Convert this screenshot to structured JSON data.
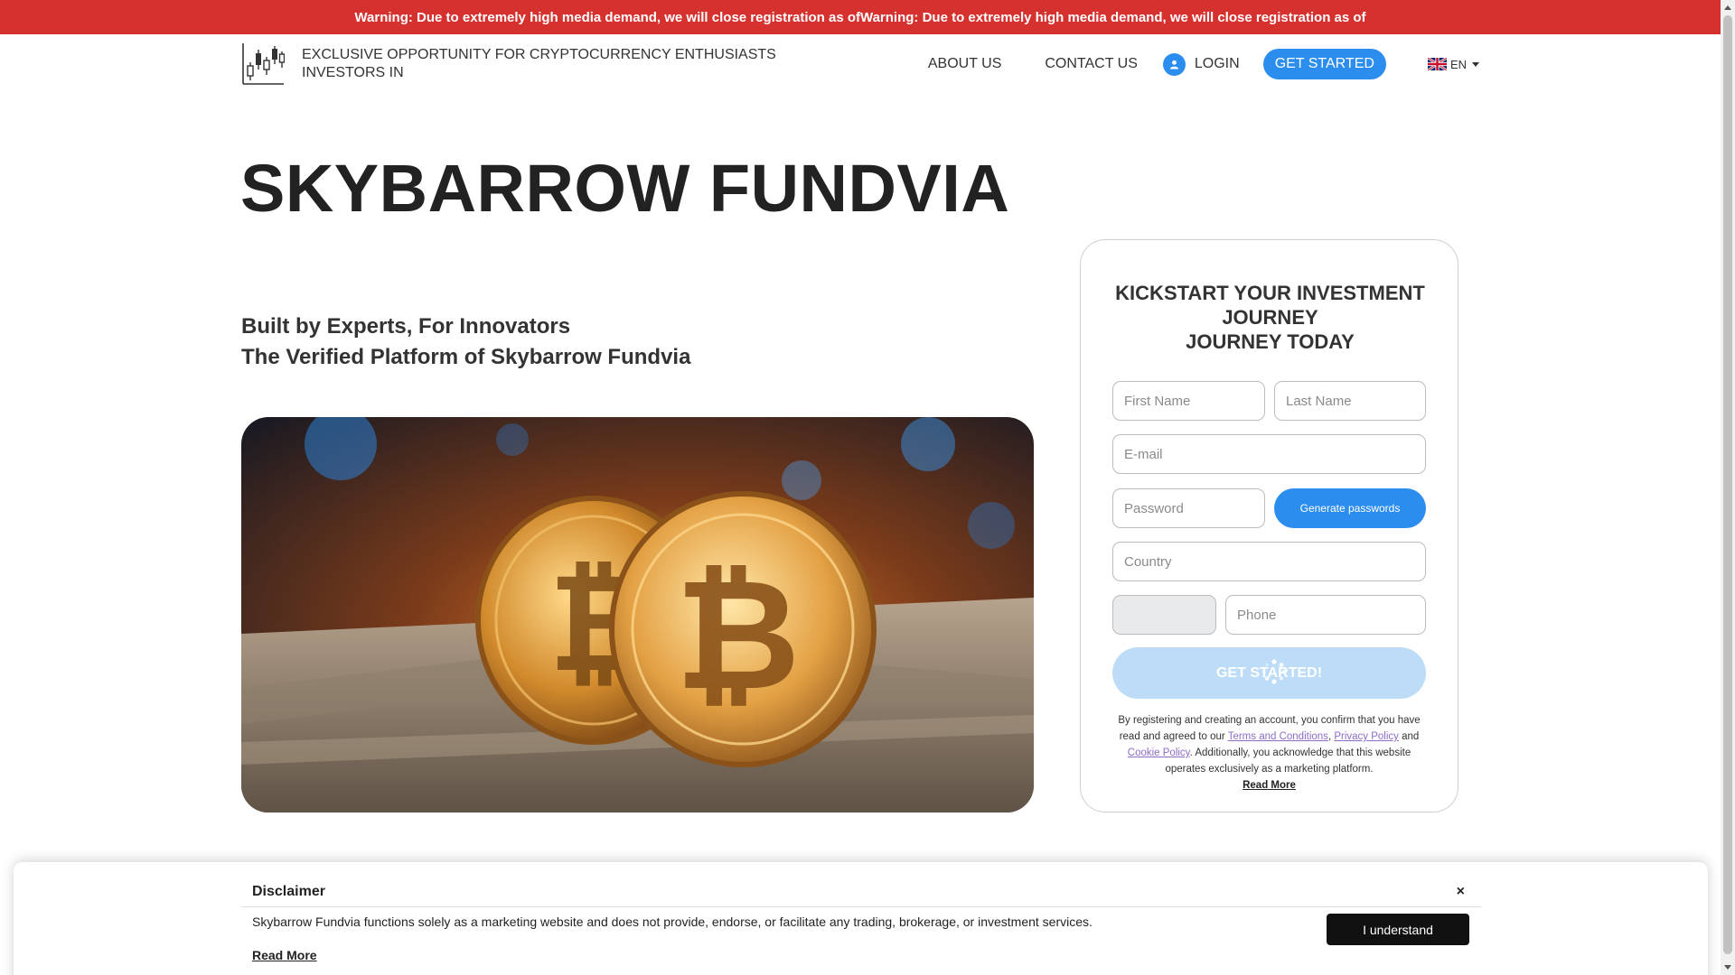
{
  "warning": {
    "text": "Warning: Due to extremely high media demand, we will close registration as ofWarning: Due to extremely high media demand, we will close registration as of"
  },
  "header": {
    "tagline": "EXCLUSIVE OPPORTUNITY FOR CRYPTOCURRENCY ENTHUSIASTS INVESTORS IN",
    "nav": {
      "about": "ABOUT US",
      "contact": "CONTACT US",
      "login": "LOGIN",
      "get_started": "GET STARTED",
      "language": "EN"
    }
  },
  "hero": {
    "title": "SKYBARROW FUNDVIA",
    "subtitle_line1": "Built by Experts, For Innovators",
    "subtitle_line2": "The Verified Platform of Skybarrow Fundvia"
  },
  "form": {
    "title_line1": "KICKSTART YOUR INVESTMENT JOURNEY",
    "title_line2": "JOURNEY TODAY",
    "first_name_placeholder": "First Name",
    "last_name_placeholder": "Last Name",
    "email_placeholder": "E-mail",
    "password_placeholder": "Password",
    "generate_label": "Generate passwords",
    "country_placeholder": "Country",
    "phone_code_value": "",
    "phone_placeholder": "Phone",
    "submit_label": "GET STARTED!",
    "legal_part1": "By registering and creating an account, you confirm that you have read and agreed to our ",
    "terms_link": "Terms and Conditions",
    "legal_comma": ", ",
    "privacy_link": "Privacy Policy",
    "legal_and": " and ",
    "cookie_link": "Cookie Policy",
    "legal_part2": ". Additionally, you acknowledge that this website operates exclusively as a marketing platform.",
    "read_more": "Read More"
  },
  "disclaimer": {
    "title": "Disclaimer",
    "close": "×",
    "text": "Skybarrow Fundvia functions solely as a marketing website and does not provide, endorse, or facilitate any trading, brokerage, or investment services.",
    "read_more": "Read More",
    "understand": "I understand"
  },
  "colors": {
    "warning_red": "#d5312f",
    "accent_blue": "#2b8ded",
    "link_purple": "#8e6cc7"
  },
  "icons": {
    "logo": "candlestick-chart-icon",
    "login": "user-icon",
    "language": "uk-flag-icon",
    "spinner": "loading-spinner-icon"
  }
}
